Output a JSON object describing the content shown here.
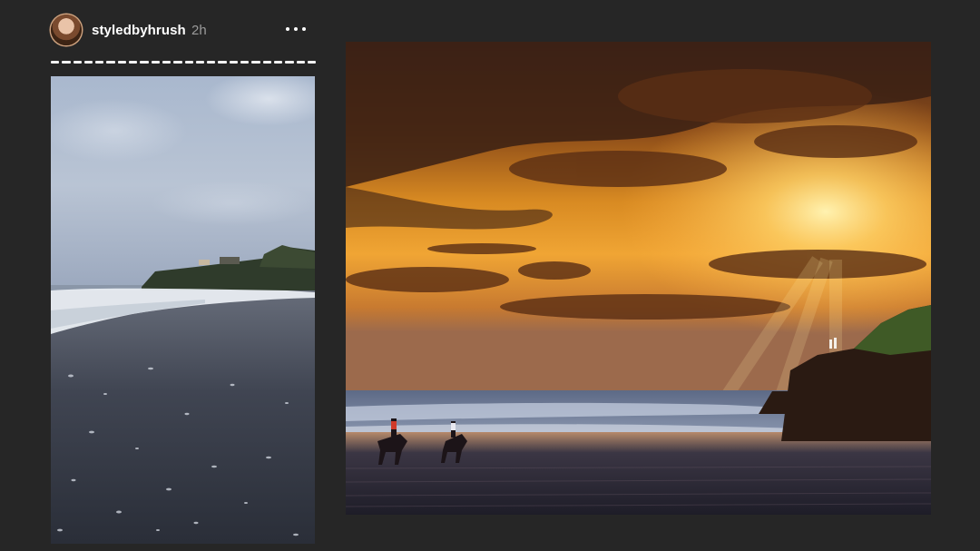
{
  "story": {
    "username": "styledbyhrush",
    "timestamp": "2h",
    "progress_segments": 24
  },
  "images": {
    "left": "beach-shore-photo",
    "right": "sunset-beach-horses-photo"
  },
  "icons": {
    "more": "more-options-icon"
  }
}
